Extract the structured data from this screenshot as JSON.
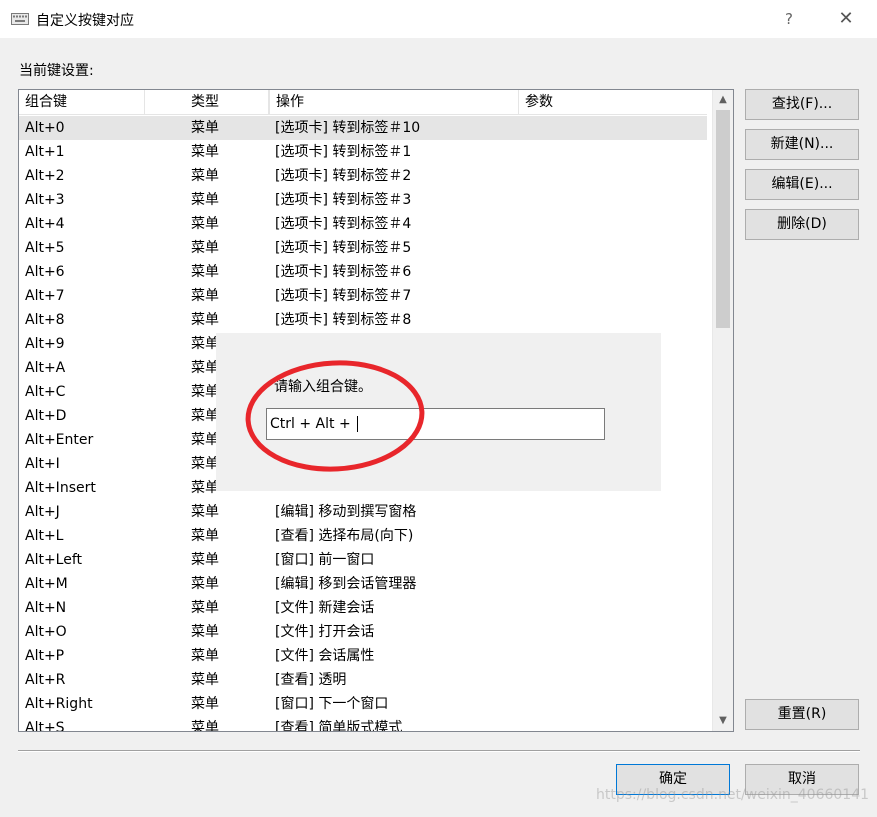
{
  "window": {
    "title": "自定义按键对应",
    "help_label": "?",
    "close_label": "✕"
  },
  "section_label": "当前键设置:",
  "columns": [
    "组合键",
    "类型",
    "操作",
    "参数"
  ],
  "rows": [
    {
      "key": "Alt+0",
      "type": "菜单",
      "op": "[选项卡] 转到标签＃10"
    },
    {
      "key": "Alt+1",
      "type": "菜单",
      "op": "[选项卡] 转到标签＃1"
    },
    {
      "key": "Alt+2",
      "type": "菜单",
      "op": "[选项卡] 转到标签＃2"
    },
    {
      "key": "Alt+3",
      "type": "菜单",
      "op": "[选项卡] 转到标签＃3"
    },
    {
      "key": "Alt+4",
      "type": "菜单",
      "op": "[选项卡] 转到标签＃4"
    },
    {
      "key": "Alt+5",
      "type": "菜单",
      "op": "[选项卡] 转到标签＃5"
    },
    {
      "key": "Alt+6",
      "type": "菜单",
      "op": "[选项卡] 转到标签＃6"
    },
    {
      "key": "Alt+7",
      "type": "菜单",
      "op": "[选项卡] 转到标签＃7"
    },
    {
      "key": "Alt+8",
      "type": "菜单",
      "op": "[选项卡] 转到标签＃8"
    },
    {
      "key": "Alt+9",
      "type": "菜单",
      "op": ""
    },
    {
      "key": "Alt+A",
      "type": "菜单",
      "op": ""
    },
    {
      "key": "Alt+C",
      "type": "菜单",
      "op": ""
    },
    {
      "key": "Alt+D",
      "type": "菜单",
      "op": ""
    },
    {
      "key": "Alt+Enter",
      "type": "菜单",
      "op": ""
    },
    {
      "key": "Alt+I",
      "type": "菜单",
      "op": ""
    },
    {
      "key": "Alt+Insert",
      "type": "菜单",
      "op": ""
    },
    {
      "key": "Alt+J",
      "type": "菜单",
      "op": "[编辑] 移动到撰写窗格"
    },
    {
      "key": "Alt+L",
      "type": "菜单",
      "op": "[查看] 选择布局(向下)"
    },
    {
      "key": "Alt+Left",
      "type": "菜单",
      "op": "[窗口] 前一窗口"
    },
    {
      "key": "Alt+M",
      "type": "菜单",
      "op": "[编辑] 移到会话管理器"
    },
    {
      "key": "Alt+N",
      "type": "菜单",
      "op": "[文件] 新建会话"
    },
    {
      "key": "Alt+O",
      "type": "菜单",
      "op": "[文件] 打开会话"
    },
    {
      "key": "Alt+P",
      "type": "菜单",
      "op": "[文件] 会话属性"
    },
    {
      "key": "Alt+R",
      "type": "菜单",
      "op": "[查看] 透明"
    },
    {
      "key": "Alt+Right",
      "type": "菜单",
      "op": "[窗口] 下一个窗口"
    },
    {
      "key": "Alt+S",
      "type": "菜单",
      "op": "[查看] 简单版式模式"
    }
  ],
  "buttons": {
    "find": "查找(F)...",
    "new": "新建(N)...",
    "edit": "编辑(E)...",
    "delete": "删除(D)",
    "reset": "重置(R)",
    "ok": "确定",
    "cancel": "取消"
  },
  "popup": {
    "prompt": "请输入组合键。",
    "value": "Ctrl + Alt + "
  },
  "watermark": "https://blog.csdn.net/weixin_40660141",
  "colors": {
    "highlight_ring": "#e8262b",
    "selected_row": "#e5e5e5",
    "default_button_border": "#0078d7"
  }
}
